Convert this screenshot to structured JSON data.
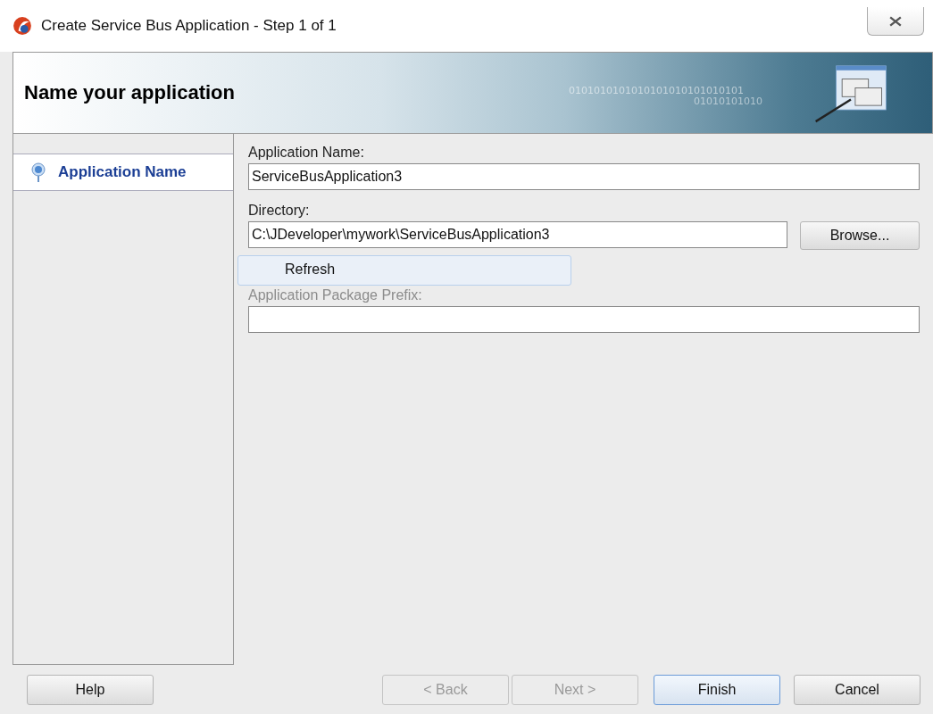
{
  "window": {
    "title": "Create Service Bus Application - Step 1 of 1"
  },
  "header": {
    "title": "Name your application",
    "pattern_text": "0101010101010101010101010101",
    "pattern_text_2": "01010101010"
  },
  "steps": [
    {
      "label": "Application Name",
      "selected": true
    }
  ],
  "fields": [
    {
      "label": "Application Name:",
      "value": "ServiceBusApplication3",
      "faded": false
    },
    {
      "label": "Directory:",
      "value": "C:\\JDeveloper\\mywork\\ServiceBusApplication3",
      "faded": false,
      "button": {
        "label": "Browse..."
      }
    },
    {
      "label": "Application Package Prefix:",
      "faded": true
    }
  ],
  "tooltip": {
    "label": "Refresh"
  },
  "buttons": [
    {
      "label": "Help",
      "disabled": false,
      "default": false
    },
    {
      "label": "< Back",
      "disabled": true,
      "default": false
    },
    {
      "label": "Next >",
      "disabled": true,
      "default": false
    },
    {
      "label": "Finish",
      "disabled": false,
      "default": true
    },
    {
      "label": "Cancel",
      "disabled": false,
      "default": false
    }
  ]
}
